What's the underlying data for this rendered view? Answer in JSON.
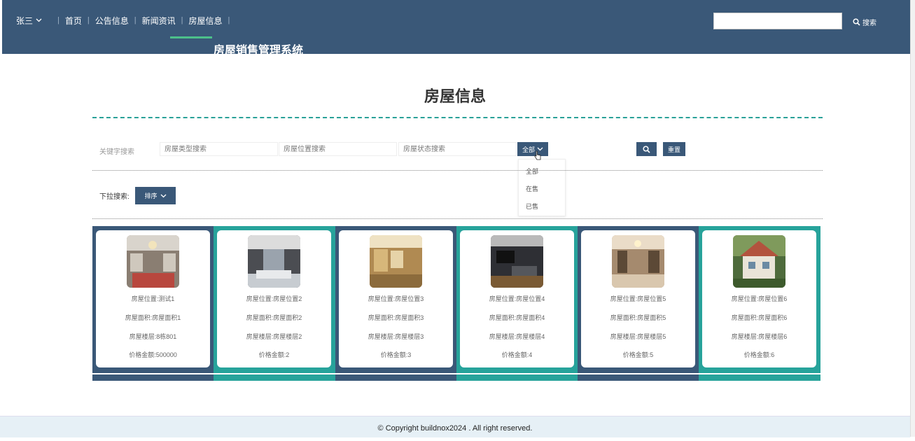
{
  "nav": {
    "user": "张三",
    "items": [
      "首页",
      "公告信息",
      "新闻资讯",
      "房屋信息"
    ],
    "brand": "房屋销售管理系统",
    "search_label": "搜索"
  },
  "page": {
    "title": "房屋信息"
  },
  "filters": {
    "label": "关键字搜索",
    "type_placeholder": "房屋类型搜索",
    "location_placeholder": "房屋位置搜索",
    "status_placeholder": "房屋状态搜索",
    "status_select": "全部",
    "status_options": [
      "全部",
      "在售",
      "已售"
    ],
    "reset_label": "重置"
  },
  "sort": {
    "label": "下拉搜索:",
    "button": "排序"
  },
  "houses": [
    {
      "location": "房屋位置:测试1",
      "area": "房屋面积:房屋面积1",
      "floor": "房屋楼层:8栋801",
      "price": "价格金额:500000"
    },
    {
      "location": "房屋位置:房屋位置2",
      "area": "房屋面积:房屋面积2",
      "floor": "房屋楼层:房屋楼层2",
      "price": "价格金额:2"
    },
    {
      "location": "房屋位置:房屋位置3",
      "area": "房屋面积:房屋面积3",
      "floor": "房屋楼层:房屋楼层3",
      "price": "价格金额:3"
    },
    {
      "location": "房屋位置:房屋位置4",
      "area": "房屋面积:房屋面积4",
      "floor": "房屋楼层:房屋楼层4",
      "price": "价格金额:4"
    },
    {
      "location": "房屋位置:房屋位置5",
      "area": "房屋面积:房屋面积5",
      "floor": "房屋楼层:房屋楼层5",
      "price": "价格金额:5"
    },
    {
      "location": "房屋位置:房屋位置6",
      "area": "房屋面积:房屋面积6",
      "floor": "房屋楼层:房屋楼层6",
      "price": "价格金额:6"
    }
  ],
  "colors": {
    "navy": "#3a5878",
    "teal": "#27a39b",
    "accent": "#4cc08a"
  },
  "footer": {
    "copyright": "© Copyright buildnox2024 . All right reserved."
  }
}
